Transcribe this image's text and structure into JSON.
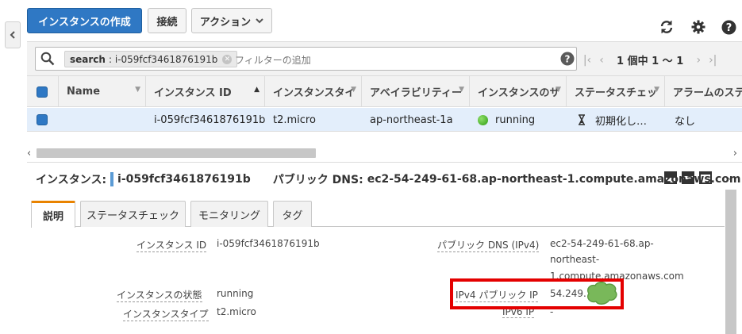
{
  "toolbar": {
    "create_label": "インスタンスの作成",
    "connect_label": "接続",
    "actions_label": "アクション",
    "refresh_icon": "refresh-icon",
    "settings_icon": "gear-icon",
    "help_icon": "help-icon"
  },
  "search": {
    "token_key": "search",
    "token_value": "i-059fcf3461876191b",
    "placeholder": "フィルターの追加"
  },
  "pagination": {
    "text": "1 個中 1 ～ 1"
  },
  "table": {
    "columns": [
      "Name",
      "インスタンス ID",
      "インスタンスタイ",
      "アベイラビリティー",
      "インスタンスのサ",
      "ステータスチェッ",
      "アラームのステ"
    ],
    "rows": [
      {
        "name": "",
        "instance_id": "i-059fcf3461876191b",
        "instance_type": "t2.micro",
        "availability_zone": "ap-northeast-1a",
        "instance_state": "running",
        "status_check": "初期化し…",
        "alarm_status": "なし"
      }
    ]
  },
  "detail": {
    "instance_label": "インスタンス:",
    "instance_id": "i-059fcf3461876191b",
    "public_dns_label": "パブリック DNS:",
    "public_dns": "ec2-54-249-61-68.ap-northeast-1.compute.amazonaws.com",
    "tabs": [
      "説明",
      "ステータスチェック",
      "モニタリング",
      "タグ"
    ],
    "fields_left": [
      {
        "label": "インスタンス ID",
        "value": "i-059fcf3461876191b"
      },
      {
        "label": "インスタンスの状態",
        "value": "running"
      },
      {
        "label": "インスタンスタイプ",
        "value": "t2.micro"
      }
    ],
    "fields_right": [
      {
        "label": "パブリック DNS (IPv4)",
        "value_lines": [
          "ec2-54-249-61-68.ap-",
          "northeast-",
          "1.compute.amazonaws.com"
        ]
      },
      {
        "label": "IPv4 パブリック IP",
        "value": "54.249."
      },
      {
        "label": "IPv6 IP",
        "value": "-"
      }
    ]
  },
  "colors": {
    "primary_button": "#2f78c4",
    "selected_row": "#e3eefb",
    "running_dot": "#2e9c12",
    "highlight_border": "#e40000",
    "active_tab_accent": "#e98300"
  }
}
